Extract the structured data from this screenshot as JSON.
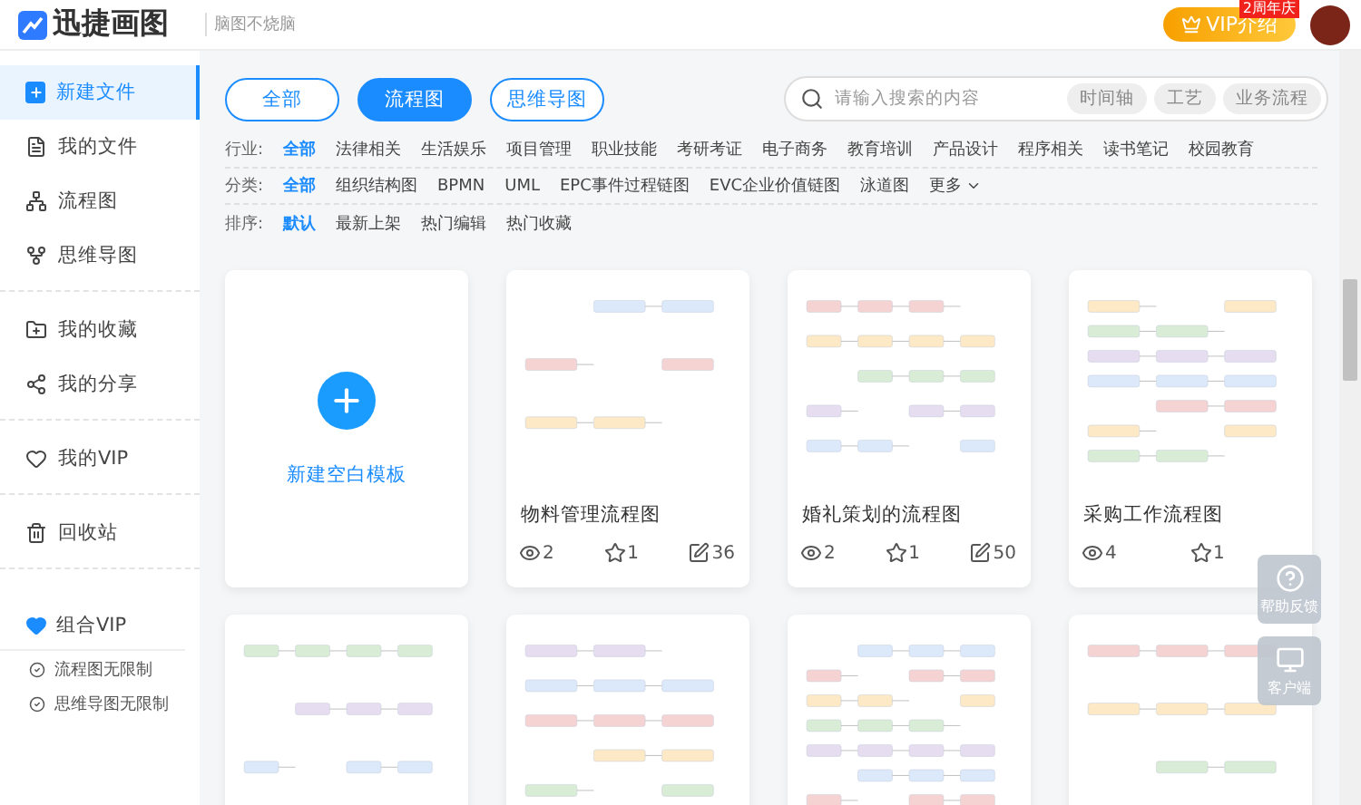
{
  "header": {
    "logo": "迅捷画图",
    "slogan": "脑图不烧脑",
    "vip_button": "VIP介绍",
    "vip_badge": "2周年庆"
  },
  "sidebar": {
    "groups": [
      [
        {
          "label": "新建文件",
          "selected": true
        },
        {
          "label": "我的文件",
          "selected": false
        },
        {
          "label": "流程图",
          "selected": false
        },
        {
          "label": "思维导图",
          "selected": false
        }
      ],
      [
        {
          "label": "我的收藏",
          "selected": false
        },
        {
          "label": "我的分享",
          "selected": false
        }
      ],
      [
        {
          "label": "我的VIP",
          "selected": false
        }
      ],
      [
        {
          "label": "回收站",
          "selected": false
        }
      ]
    ],
    "vip_section": {
      "title": "组合VIP",
      "features": [
        "流程图无限制",
        "思维导图无限制"
      ]
    }
  },
  "type_tabs": [
    {
      "label": "全部",
      "selected": false
    },
    {
      "label": "流程图",
      "selected": true
    },
    {
      "label": "思维导图",
      "selected": false
    }
  ],
  "search": {
    "placeholder": "请输入搜索的内容",
    "tags": [
      "时间轴",
      "工艺",
      "业务流程"
    ]
  },
  "filters": [
    {
      "label": "行业:",
      "options": [
        {
          "label": "全部",
          "selected": true
        },
        {
          "label": "法律相关",
          "selected": false
        },
        {
          "label": "生活娱乐",
          "selected": false
        },
        {
          "label": "项目管理",
          "selected": false
        },
        {
          "label": "职业技能",
          "selected": false
        },
        {
          "label": "考研考证",
          "selected": false
        },
        {
          "label": "电子商务",
          "selected": false
        },
        {
          "label": "教育培训",
          "selected": false
        },
        {
          "label": "产品设计",
          "selected": false
        },
        {
          "label": "程序相关",
          "selected": false
        },
        {
          "label": "读书笔记",
          "selected": false
        },
        {
          "label": "校园教育",
          "selected": false
        }
      ]
    },
    {
      "label": "分类:",
      "options": [
        {
          "label": "全部",
          "selected": true
        },
        {
          "label": "组织结构图",
          "selected": false
        },
        {
          "label": "BPMN",
          "selected": false
        },
        {
          "label": "UML",
          "selected": false
        },
        {
          "label": "EPC事件过程链图",
          "selected": false
        },
        {
          "label": "EVC企业价值链图",
          "selected": false
        },
        {
          "label": "泳道图",
          "selected": false
        }
      ],
      "more": "更多"
    },
    {
      "label": "排序:",
      "options": [
        {
          "label": "默认",
          "selected": true
        },
        {
          "label": "最新上架",
          "selected": false
        },
        {
          "label": "热门编辑",
          "selected": false
        },
        {
          "label": "热门收藏",
          "selected": false
        }
      ]
    }
  ],
  "new_card": {
    "label": "新建空白模板"
  },
  "templates": [
    {
      "kind": "full",
      "title": "物料管理流程图",
      "views": "2",
      "stars": "1",
      "edits": "36"
    },
    {
      "kind": "full",
      "title": "婚礼策划的流程图",
      "views": "2",
      "stars": "1",
      "edits": "50"
    },
    {
      "kind": "full",
      "title": "采购工作流程图",
      "views": "4",
      "stars": "1"
    },
    {
      "kind": "thumbnail"
    },
    {
      "kind": "thumbnail"
    },
    {
      "kind": "thumbnail"
    },
    {
      "kind": "thumbnail"
    }
  ],
  "float_buttons": [
    {
      "label": "帮助反馈"
    },
    {
      "label": "客户端"
    }
  ]
}
